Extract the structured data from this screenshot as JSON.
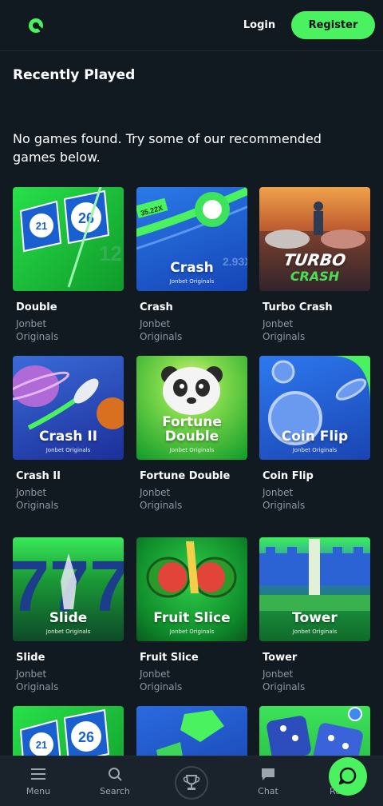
{
  "header": {
    "login_label": "Login",
    "register_label": "Register",
    "accent": "#4af25f"
  },
  "section": {
    "title": "Recently Played",
    "empty_message": "No games found. Try some of our recommended games below."
  },
  "games": [
    {
      "name": "Double",
      "provider": "Jonbet Originals",
      "thumb_title": "",
      "thumb_sub": "",
      "bg": "#1ec93a",
      "icon": "double-ball-icon"
    },
    {
      "name": "Crash",
      "provider": "Jonbet Originals",
      "thumb_title": "Crash",
      "thumb_sub": "Jonbet Originals",
      "bg": "#1858c8",
      "icon": "crash-ball-icon"
    },
    {
      "name": "Turbo Crash",
      "provider": "Jonbet Originals",
      "thumb_title": "TURBO",
      "thumb_sub": "CRASH",
      "bg": "#c7762f",
      "icon": "racecar-icon"
    },
    {
      "name": "Crash II",
      "provider": "Jonbet Originals",
      "thumb_title": "Crash II",
      "thumb_sub": "Jonbet Originals",
      "bg": "#1f46b8",
      "icon": "rocket-icon"
    },
    {
      "name": "Fortune Double",
      "provider": "Jonbet Originals",
      "thumb_title": "Fortune Double",
      "thumb_sub": "Jonbet Originals",
      "bg": "#17b53a",
      "icon": "panda-icon"
    },
    {
      "name": "Coin Flip",
      "provider": "Jonbet Originals",
      "thumb_title": "Coin Flip",
      "thumb_sub": "Jonbet Originals",
      "bg": "#1e5ed6",
      "icon": "coin-icon"
    },
    {
      "name": "Slide",
      "provider": "Jonbet Originals",
      "thumb_title": "Slide",
      "thumb_sub": "Jonbet Originals",
      "bg": "#159c2c",
      "icon": "slide-rocket-icon"
    },
    {
      "name": "Fruit Slice",
      "provider": "Jonbet Originals",
      "thumb_title": "Fruit Slice",
      "thumb_sub": "Jonbet Originals",
      "bg": "#10a32e",
      "icon": "watermelon-icon"
    },
    {
      "name": "Tower",
      "provider": "Jonbet Originals",
      "thumb_title": "Tower",
      "thumb_sub": "Jonbet Originals",
      "bg": "#1aa34a",
      "icon": "tower-icon"
    },
    {
      "name": "",
      "provider": "",
      "thumb_title": "",
      "thumb_sub": "",
      "bg": "#1ec93a",
      "icon": "double-ball-icon"
    },
    {
      "name": "",
      "provider": "",
      "thumb_title": "",
      "thumb_sub": "",
      "bg": "#1c4fbf",
      "icon": "gem-icon"
    },
    {
      "name": "",
      "provider": "",
      "thumb_title": "",
      "thumb_sub": "",
      "bg": "#22c23d",
      "icon": "dice-icon"
    }
  ],
  "bottom_nav": {
    "menu_label": "Menu",
    "search_label": "Search",
    "chat_label": "Chat",
    "rewards_label": "Re"
  }
}
